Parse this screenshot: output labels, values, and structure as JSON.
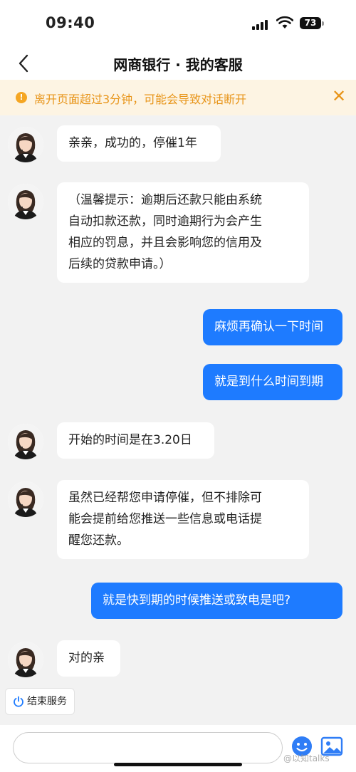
{
  "status_bar": {
    "time": "09:40",
    "battery": "73"
  },
  "nav": {
    "title": "网商银行 · 我的客服"
  },
  "notice": {
    "text": "离开页面超过3分钟，可能会导致对话断开"
  },
  "messages": [
    {
      "from": "bot",
      "lines": [
        "亲亲，成功的，停催1年"
      ]
    },
    {
      "from": "bot",
      "lines": [
        "（温馨提示：逾期后还款只能由系统",
        "自动扣款还款，同时逾期行为会产生",
        "相应的罚息，并且会影响您的信用及",
        "后续的贷款申请。）"
      ]
    },
    {
      "from": "user",
      "lines": [
        "麻烦再确认一下时间"
      ]
    },
    {
      "from": "user",
      "lines": [
        "就是到什么时间到期"
      ]
    },
    {
      "from": "bot",
      "lines": [
        "开始的时间是在3.20日"
      ]
    },
    {
      "from": "bot",
      "lines": [
        "虽然已经帮您申请停催，但不排除可",
        "能会提前给您推送一些信息或电话提",
        "醒您还款。"
      ]
    },
    {
      "from": "user",
      "lines": [
        "就是快到期的时候推送或致电是吧?"
      ]
    },
    {
      "from": "bot",
      "lines": [
        "对的亲"
      ]
    }
  ],
  "end_service": {
    "label": "结束服务"
  },
  "watermark": "@以知talks",
  "icons": {
    "back": "chevron-left-icon",
    "close": "close-icon",
    "warning": "exclamation-icon",
    "emoji": "smiley-icon",
    "image": "image-icon",
    "power": "power-icon"
  },
  "colors": {
    "user_bubble": "#1e7bff",
    "notice_text": "#e8951a",
    "notice_bg": "#fdf4e3"
  }
}
